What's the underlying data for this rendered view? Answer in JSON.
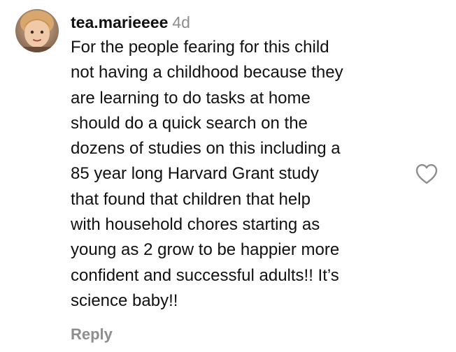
{
  "comment": {
    "username": "tea.marieeee",
    "time": "4d",
    "text_lines": [
      "For the people fearing for this child",
      "not having a childhood because they",
      "are learning to do tasks at home",
      "should do a quick search on the",
      "dozens of studies on this including a",
      "85 year long Harvard Grant study",
      "that found that children that help",
      "with household chores starting as",
      "young as 2 grow to be happier more",
      "confident and successful adults!! It’s",
      "science baby!!"
    ],
    "reply_label": "Reply",
    "avatar_icon": "profile-photo",
    "like_icon": "heart-outline-icon"
  },
  "colors": {
    "primary_text": "#111111",
    "secondary_text": "#8e8e8e",
    "icon_stroke": "#8e8e8e",
    "background": "#ffffff"
  }
}
